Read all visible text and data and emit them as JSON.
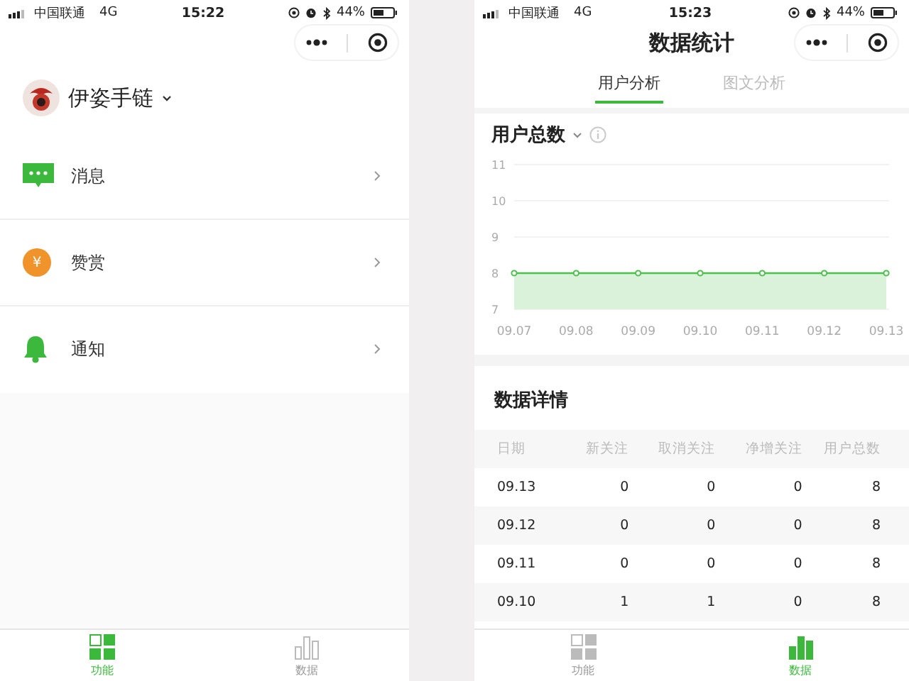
{
  "left_screen": {
    "status_bar": {
      "carrier": "中国联通",
      "network": "4G",
      "time": "15:22",
      "battery": "44%"
    },
    "profile": {
      "name": "伊姿手链"
    },
    "menu": [
      {
        "label": "消息",
        "kind": "message"
      },
      {
        "label": "赞赏",
        "kind": "reward",
        "icon_text": "¥"
      },
      {
        "label": "通知",
        "kind": "bell"
      }
    ],
    "tab_bar": [
      {
        "label": "功能",
        "kind": "grid",
        "selected": true
      },
      {
        "label": "数据",
        "kind": "bars",
        "selected": false
      }
    ]
  },
  "right_screen": {
    "status_bar": {
      "carrier": "中国联通",
      "network": "4G",
      "time": "15:23",
      "battery": "44%"
    },
    "title": "数据统计",
    "tabs": [
      {
        "label": "用户分析",
        "selected": true
      },
      {
        "label": "图文分析",
        "selected": false
      }
    ],
    "metric": {
      "title": "用户总数",
      "chart_data": {
        "type": "area",
        "categories": [
          "09.07",
          "09.08",
          "09.09",
          "09.10",
          "09.11",
          "09.12",
          "09.13"
        ],
        "series": [
          {
            "color": "#4cbf4c",
            "values": [
              8,
              8,
              8,
              8,
              8,
              8,
              8
            ]
          }
        ],
        "ylim": [
          7,
          11
        ],
        "yticks": [
          7,
          8,
          9,
          10,
          11
        ]
      }
    },
    "details": {
      "title": "数据详情",
      "columns": [
        "日期",
        "新关注",
        "取消关注",
        "净增关注",
        "用户总数"
      ],
      "rows": [
        [
          "09.13",
          "0",
          "0",
          "0",
          "8"
        ],
        [
          "09.12",
          "0",
          "0",
          "0",
          "8"
        ],
        [
          "09.11",
          "0",
          "0",
          "0",
          "8"
        ],
        [
          "09.10",
          "1",
          "1",
          "0",
          "8"
        ]
      ]
    },
    "tab_bar": [
      {
        "label": "功能",
        "kind": "grid",
        "selected": false
      },
      {
        "label": "数据",
        "kind": "bars",
        "selected": true
      }
    ]
  }
}
